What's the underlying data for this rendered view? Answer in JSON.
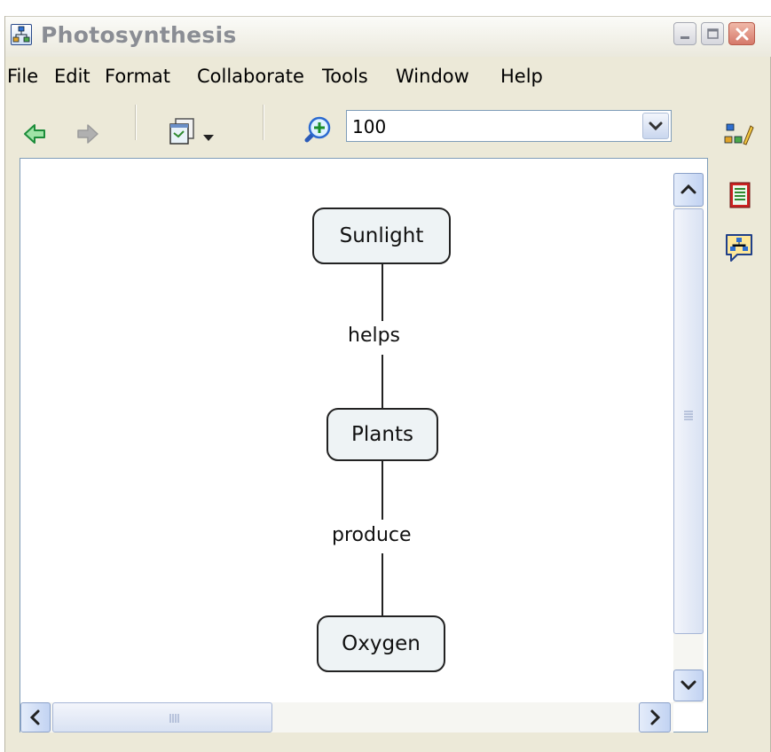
{
  "window": {
    "title": "Photosynthesis",
    "icon": "cmap-document-icon",
    "buttons": [
      "minimize",
      "maximize",
      "close"
    ]
  },
  "menu": {
    "items": [
      "File",
      "Edit",
      "Format",
      "Collaborate",
      "Tools",
      "Window",
      "Help"
    ]
  },
  "toolbar": {
    "back_icon": "back-arrow-icon",
    "forward_icon": "forward-arrow-icon",
    "view_icon": "view-mode-icon",
    "zoom_icon": "zoom-in-icon",
    "zoom_value": "100",
    "side_icons": [
      "style-palette-icon",
      "notes-icon",
      "discussion-icon"
    ]
  },
  "concept_map": {
    "nodes": [
      {
        "id": "sunlight",
        "label": "Sunlight"
      },
      {
        "id": "plants",
        "label": "Plants"
      },
      {
        "id": "oxygen",
        "label": "Oxygen"
      }
    ],
    "links": [
      {
        "from": "sunlight",
        "to": "plants",
        "label": "helps"
      },
      {
        "from": "plants",
        "to": "oxygen",
        "label": "produce"
      }
    ]
  },
  "colors": {
    "window_bg": "#ece9d8",
    "node_fill": "#eef3f5",
    "node_border": "#222222",
    "title_text": "#8a8d94",
    "scroll_blue": "#c2d3f2"
  }
}
